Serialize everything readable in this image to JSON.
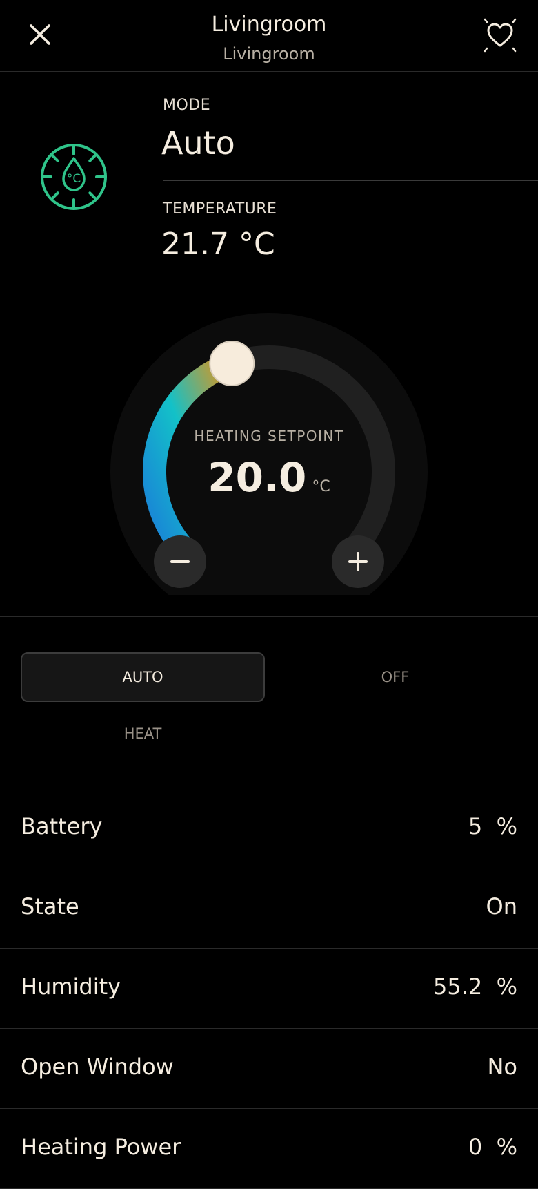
{
  "header": {
    "title": "Livingroom",
    "subtitle": "Livingroom",
    "close_icon": "close-icon",
    "favorite_icon": "heart-sparkle-icon"
  },
  "info": {
    "icon": "thermostat-icon",
    "icon_color": "#2fc48a",
    "mode_label": "MODE",
    "mode_value": "Auto",
    "temperature_label": "TEMPERATURE",
    "temperature_value": "21.7 °C"
  },
  "dial": {
    "label": "HEATING SETPOINT",
    "value": "20.0",
    "unit": "°C",
    "level": 0.43,
    "gradient_colors": [
      "#1a7fd8",
      "#13c1c8",
      "#f5900a"
    ],
    "handle_color": "#f7ecdc",
    "minus_icon": "minus-icon",
    "plus_icon": "plus-icon"
  },
  "modes": [
    {
      "label": "AUTO",
      "active": true
    },
    {
      "label": "OFF",
      "active": false
    },
    {
      "label": "HEAT",
      "active": false
    }
  ],
  "attributes": [
    {
      "name": "Battery",
      "value": "5  %"
    },
    {
      "name": "State",
      "value": "On"
    },
    {
      "name": "Humidity",
      "value": "55.2  %"
    },
    {
      "name": "Open Window",
      "value": "No"
    },
    {
      "name": "Heating Power",
      "value": "0  %"
    }
  ]
}
